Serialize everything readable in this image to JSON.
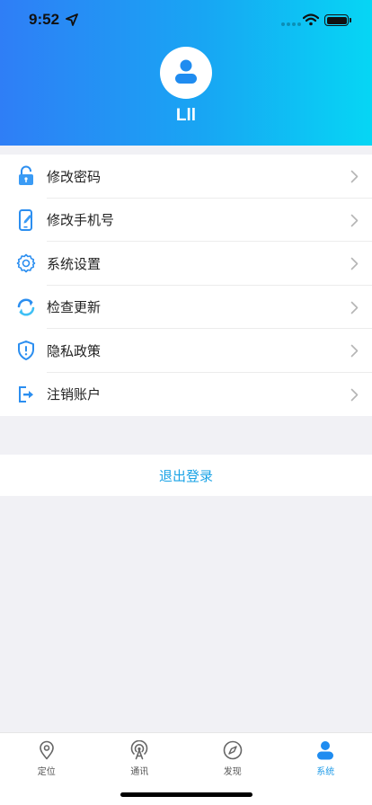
{
  "status_bar": {
    "time": "9:52"
  },
  "profile": {
    "username": "Lll"
  },
  "menu": {
    "items": [
      {
        "label": "修改密码"
      },
      {
        "label": "修改手机号"
      },
      {
        "label": "系统设置"
      },
      {
        "label": "检查更新"
      },
      {
        "label": "隐私政策"
      },
      {
        "label": "注销账户"
      }
    ]
  },
  "logout": {
    "label": "退出登录"
  },
  "tabbar": {
    "tabs": [
      {
        "label": "定位",
        "icon": "location-pin-icon"
      },
      {
        "label": "通讯",
        "icon": "broadcast-tower-icon"
      },
      {
        "label": "发现",
        "icon": "compass-icon"
      },
      {
        "label": "系统",
        "icon": "user-icon",
        "active": true
      }
    ]
  },
  "colors": {
    "accent": "#1aa3e6",
    "header_start": "#2f7ef6",
    "header_end": "#06d6f4"
  }
}
